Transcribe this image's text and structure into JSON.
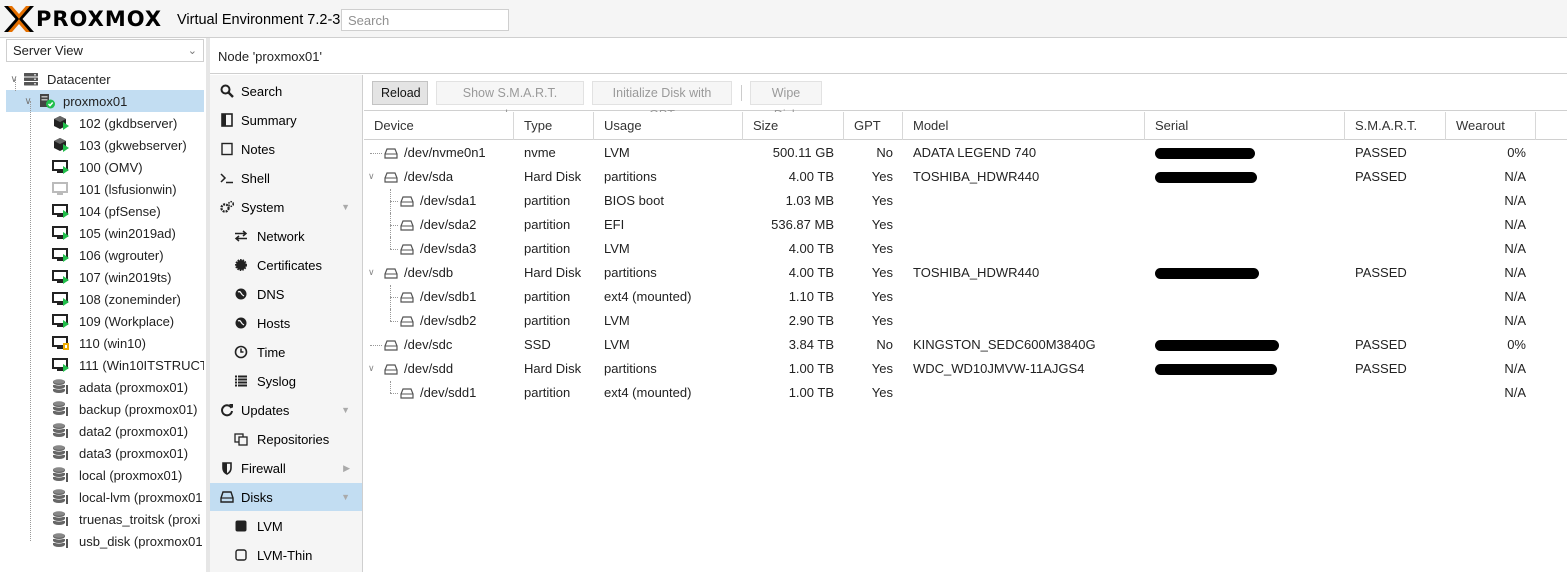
{
  "header": {
    "logo_text": "PROXMOX",
    "app_version": "Virtual Environment 7.2-3",
    "search_placeholder": "Search",
    "logo_color": "#e57000"
  },
  "left_panel": {
    "view_select": "Server View",
    "tree": [
      {
        "label": "Datacenter",
        "icon": "datacenter-icon",
        "level": 0
      },
      {
        "label": "proxmox01",
        "icon": "node-online-icon",
        "level": 1,
        "selected": true
      },
      {
        "label": "102 (gkdbserver)",
        "icon": "container-running-icon",
        "level": 2
      },
      {
        "label": "103 (gkwebserver)",
        "icon": "container-running-icon",
        "level": 2
      },
      {
        "label": "100 (OMV)",
        "icon": "vm-running-icon",
        "level": 2
      },
      {
        "label": "101 (lsfusionwin)",
        "icon": "vm-stopped-icon",
        "level": 2
      },
      {
        "label": "104 (pfSense)",
        "icon": "vm-running-icon",
        "level": 2
      },
      {
        "label": "105 (win2019ad)",
        "icon": "vm-running-icon",
        "level": 2
      },
      {
        "label": "106 (wgrouter)",
        "icon": "vm-running-icon",
        "level": 2
      },
      {
        "label": "107 (win2019ts)",
        "icon": "vm-running-icon",
        "level": 2
      },
      {
        "label": "108 (zoneminder)",
        "icon": "vm-running-icon",
        "level": 2
      },
      {
        "label": "109 (Workplace)",
        "icon": "vm-running-icon",
        "level": 2
      },
      {
        "label": "110 (win10)",
        "icon": "vm-locked-icon",
        "level": 2
      },
      {
        "label": "111 (Win10ITSTRUCT",
        "icon": "vm-running-icon",
        "level": 2
      },
      {
        "label": "adata (proxmox01)",
        "icon": "storage-icon",
        "level": 2
      },
      {
        "label": "backup (proxmox01)",
        "icon": "storage-icon",
        "level": 2
      },
      {
        "label": "data2 (proxmox01)",
        "icon": "storage-icon",
        "level": 2
      },
      {
        "label": "data3 (proxmox01)",
        "icon": "storage-icon",
        "level": 2
      },
      {
        "label": "local (proxmox01)",
        "icon": "storage-icon",
        "level": 2
      },
      {
        "label": "local-lvm (proxmox01",
        "icon": "storage-icon",
        "level": 2
      },
      {
        "label": "truenas_troitsk (proxi",
        "icon": "storage-icon",
        "level": 2
      },
      {
        "label": "usb_disk (proxmox01",
        "icon": "storage-icon",
        "level": 2
      }
    ]
  },
  "breadcrumb": "Node 'proxmox01'",
  "node_menu": [
    {
      "label": "Search",
      "icon": "search-icon",
      "indent": 0
    },
    {
      "label": "Summary",
      "icon": "summary-icon",
      "indent": 0
    },
    {
      "label": "Notes",
      "icon": "notes-icon",
      "indent": 0
    },
    {
      "label": "Shell",
      "icon": "terminal-icon",
      "indent": 0
    },
    {
      "label": "System",
      "icon": "gears-icon",
      "indent": 0,
      "expandable": true,
      "chevron": "down"
    },
    {
      "label": "Network",
      "icon": "network-icon",
      "indent": 1
    },
    {
      "label": "Certificates",
      "icon": "certificate-icon",
      "indent": 1
    },
    {
      "label": "DNS",
      "icon": "globe-icon",
      "indent": 1
    },
    {
      "label": "Hosts",
      "icon": "globe-icon",
      "indent": 1
    },
    {
      "label": "Time",
      "icon": "clock-icon",
      "indent": 1
    },
    {
      "label": "Syslog",
      "icon": "list-icon",
      "indent": 1
    },
    {
      "label": "Updates",
      "icon": "refresh-icon",
      "indent": 0,
      "expandable": true,
      "chevron": "down"
    },
    {
      "label": "Repositories",
      "icon": "repositories-icon",
      "indent": 1
    },
    {
      "label": "Firewall",
      "icon": "shield-icon",
      "indent": 0,
      "expandable": true,
      "chevron": "right"
    },
    {
      "label": "Disks",
      "icon": "disk-icon",
      "indent": 0,
      "expandable": true,
      "chevron": "down",
      "selected": true
    },
    {
      "label": "LVM",
      "icon": "lvm-icon",
      "indent": 1
    },
    {
      "label": "LVM-Thin",
      "icon": "lvm-thin-icon",
      "indent": 1
    }
  ],
  "toolbar": {
    "reload": "Reload",
    "smart": "Show S.M.A.R.T. values",
    "init_gpt": "Initialize Disk with GPT",
    "wipe": "Wipe Disk"
  },
  "grid": {
    "columns": [
      "Device",
      "Type",
      "Usage",
      "Size",
      "GPT",
      "Model",
      "Serial",
      "S.M.A.R.T.",
      "Wearout"
    ],
    "rows": [
      {
        "device": "/dev/nvme0n1",
        "level": 0,
        "expandable": false,
        "type": "nvme",
        "usage": "LVM",
        "size": "500.11 GB",
        "gpt": "No",
        "model": "ADATA LEGEND 740",
        "serial_redacted": true,
        "smart": "PASSED",
        "wearout": "0%"
      },
      {
        "device": "/dev/sda",
        "level": 0,
        "expandable": true,
        "type": "Hard Disk",
        "usage": "partitions",
        "size": "4.00 TB",
        "gpt": "Yes",
        "model": "TOSHIBA_HDWR440",
        "serial_redacted": true,
        "smart": "PASSED",
        "wearout": "N/A"
      },
      {
        "device": "/dev/sda1",
        "level": 1,
        "expandable": false,
        "type": "partition",
        "usage": "BIOS boot",
        "size": "1.03 MB",
        "gpt": "Yes",
        "model": "",
        "serial_redacted": false,
        "smart": "",
        "wearout": "N/A"
      },
      {
        "device": "/dev/sda2",
        "level": 1,
        "expandable": false,
        "type": "partition",
        "usage": "EFI",
        "size": "536.87 MB",
        "gpt": "Yes",
        "model": "",
        "serial_redacted": false,
        "smart": "",
        "wearout": "N/A"
      },
      {
        "device": "/dev/sda3",
        "level": 1,
        "expandable": false,
        "type": "partition",
        "usage": "LVM",
        "size": "4.00 TB",
        "gpt": "Yes",
        "model": "",
        "serial_redacted": false,
        "smart": "",
        "wearout": "N/A"
      },
      {
        "device": "/dev/sdb",
        "level": 0,
        "expandable": true,
        "type": "Hard Disk",
        "usage": "partitions",
        "size": "4.00 TB",
        "gpt": "Yes",
        "model": "TOSHIBA_HDWR440",
        "serial_redacted": true,
        "smart": "PASSED",
        "wearout": "N/A"
      },
      {
        "device": "/dev/sdb1",
        "level": 1,
        "expandable": false,
        "type": "partition",
        "usage": "ext4 (mounted)",
        "size": "1.10 TB",
        "gpt": "Yes",
        "model": "",
        "serial_redacted": false,
        "smart": "",
        "wearout": "N/A"
      },
      {
        "device": "/dev/sdb2",
        "level": 1,
        "expandable": false,
        "type": "partition",
        "usage": "LVM",
        "size": "2.90 TB",
        "gpt": "Yes",
        "model": "",
        "serial_redacted": false,
        "smart": "",
        "wearout": "N/A"
      },
      {
        "device": "/dev/sdc",
        "level": 0,
        "expandable": false,
        "type": "SSD",
        "usage": "LVM",
        "size": "3.84 TB",
        "gpt": "No",
        "model": "KINGSTON_SEDC600M3840G",
        "serial_redacted": true,
        "smart": "PASSED",
        "wearout": "0%"
      },
      {
        "device": "/dev/sdd",
        "level": 0,
        "expandable": true,
        "type": "Hard Disk",
        "usage": "partitions",
        "size": "1.00 TB",
        "gpt": "Yes",
        "model": "WDC_WD10JMVW-11AJGS4",
        "serial_redacted": true,
        "smart": "PASSED",
        "wearout": "N/A"
      },
      {
        "device": "/dev/sdd1",
        "level": 1,
        "expandable": false,
        "type": "partition",
        "usage": "ext4 (mounted)",
        "size": "1.00 TB",
        "gpt": "Yes",
        "model": "",
        "serial_redacted": false,
        "smart": "",
        "wearout": "N/A"
      }
    ]
  }
}
